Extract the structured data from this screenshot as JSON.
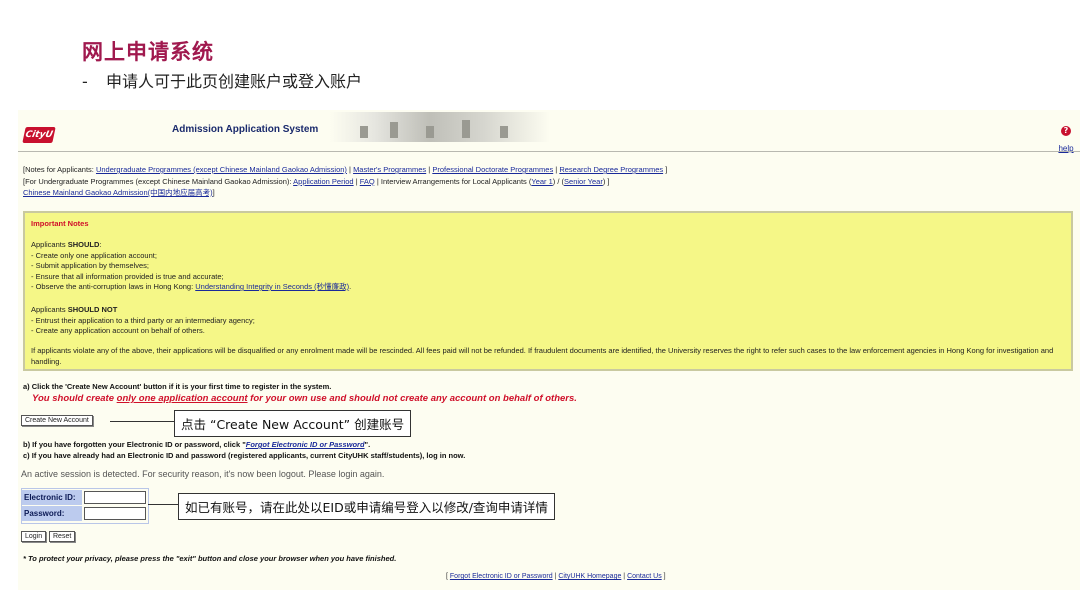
{
  "slide": {
    "title": "网上申请系统",
    "subtitle_dash": "-",
    "subtitle": "申请人可于此页创建账户或登入账户"
  },
  "header": {
    "logo": "CityU",
    "title": "Admission Application System",
    "help": "help"
  },
  "notes": {
    "line1_prefix": "[Notes for Applicants:",
    "line1_links": [
      "Undergraduate Programmes (except Chinese Mainland Gaokao Admission)",
      "Master's Programmes",
      "Professional Doctorate Programmes",
      "Research Degree Programmes"
    ],
    "line1_suffix": "]",
    "line2_prefix": "[For Undergraduate Programmes (except Chinese Mainland Gaokao Admission):",
    "line2_link1": "Application Period",
    "line2_link2": "FAQ",
    "line2_mid": "Interview Arrangements for Local Applicants (",
    "line2_link3": "Year 1",
    "line2_mid2": ") / (",
    "line2_link4": "Senior Year",
    "line2_suffix": ") ]",
    "line3_link": "Chinese Mainland Gaokao Admission(中国内地应届高考)",
    "line3_suffix": "]"
  },
  "important": {
    "title": "Important Notes",
    "should_prefix": "Applicants ",
    "should_bold": "SHOULD",
    "should_colon": ":",
    "should_items": [
      "- Create only one application account;",
      "- Submit application by themselves;",
      "- Ensure that all information provided is true and accurate;"
    ],
    "anti_prefix": "- Observe the anti-corruption laws in Hong Kong: ",
    "anti_link": "Understanding Integrity in Seconds (秒懂廉政)",
    "anti_suffix": ".",
    "shouldnot_prefix": "Applicants ",
    "shouldnot_bold": "SHOULD NOT",
    "shouldnot_items": [
      "- Entrust their application to a third party or an intermediary agency;",
      "- Create any application account on behalf of others."
    ],
    "violation": "If applicants violate any of the above, their applications will be disqualified or any enrolment made will be rescinded. All fees paid will not be refunded. If fraudulent documents are identified, the University reserves the right to refer such cases to the law enforcement agencies in Hong Kong for investigation and handling."
  },
  "step_a": "a) Click the 'Create New Account' button if it is your first time to register in the system.",
  "warning": {
    "prefix": "You should create ",
    "underlined": "only one application account",
    "suffix": " for your own use and should not create any account on behalf of others."
  },
  "create_button": "Create New Account",
  "callout_create": "点击 “Create New Account” 创建账号",
  "step_b_prefix": "b) If you have forgotten your Electronic ID or password, click \"",
  "step_b_link": "Forgot Electronic ID or Password",
  "step_b_suffix": "\".",
  "step_c": "c) If you have already had an Electronic ID and password (registered applicants, current CityUHK staff/students), log in now.",
  "session_msg": "An active session is detected. For security reason, it's now been logout. Please login again.",
  "login": {
    "eid_label": "Electronic ID:",
    "pwd_label": "Password:",
    "eid_value": "",
    "pwd_value": "",
    "login_button": "Login",
    "reset_button": "Reset"
  },
  "callout_login": "如已有账号，请在此处以EID或申请编号登入以修改/查询申请详情",
  "privacy": "* To protect your privacy, please press the \"exit\" button and close your browser when you have finished.",
  "footer": {
    "open": "[",
    "links": [
      "Forgot Electronic ID or Password",
      "CityUHK Homepage",
      "Contact Us"
    ],
    "sep": " | ",
    "close": "]"
  }
}
